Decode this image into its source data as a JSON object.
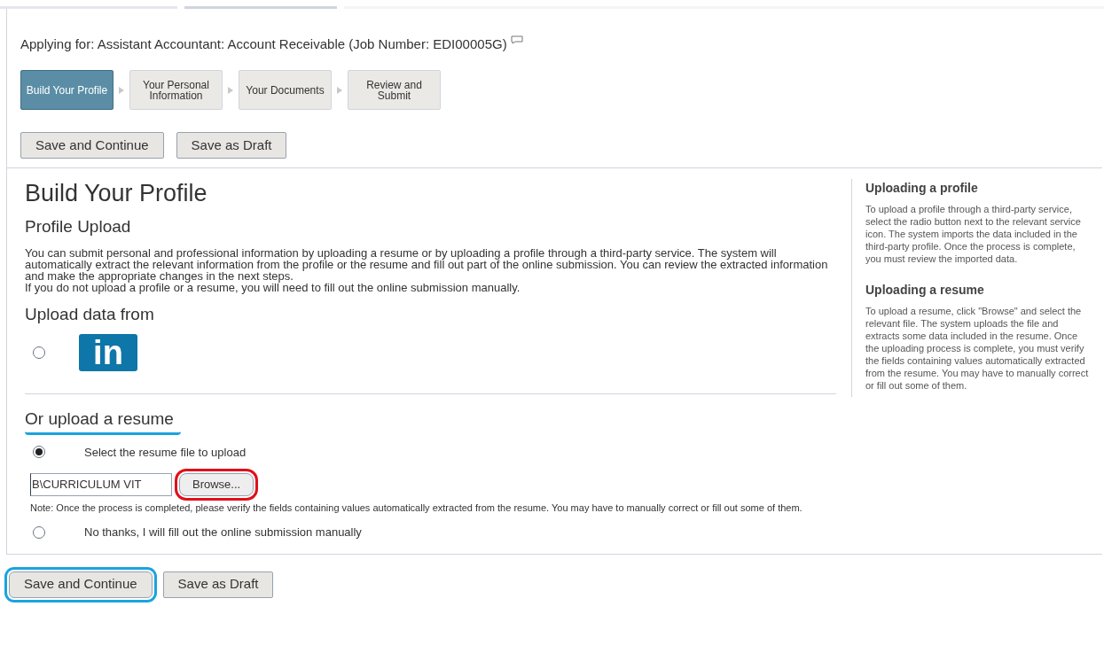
{
  "header": {
    "label": "Applying for:",
    "job_title": "Assistant Accountant: Account Receivable (Job Number: EDI00005G)"
  },
  "steps": [
    {
      "label": "Build Your Profile",
      "selected": true
    },
    {
      "label": "Your Personal Information",
      "selected": false
    },
    {
      "label": "Your Documents",
      "selected": false
    },
    {
      "label": "Review and Submit",
      "selected": false
    }
  ],
  "top_buttons": [
    {
      "label": "Save and Continue",
      "circled": false
    },
    {
      "label": "Save as Draft",
      "circled": false
    }
  ],
  "main": {
    "title": "Build Your Profile",
    "subtitle": "Profile Upload",
    "paragraphs": [
      "You can submit personal and professional information by uploading a resume or by uploading a profile through a third-party service. The system will automatically extract the relevant information from the profile or the resume and fill out part of the online submission. You can review the extracted information and make the appropriate changes in the next steps.",
      "If you do not upload a profile or a resume, you will need to fill out the online submission manually."
    ],
    "upload_heading": "Upload data from",
    "service": {
      "logo_text": "in",
      "selected": false
    },
    "resume_heading": {
      "text": "Or upload a resume",
      "underlined": true
    },
    "resume_option": {
      "label": "Select the resume file to upload",
      "selected": true
    },
    "file_field": {
      "value": "B\\CURRICULUM VIT"
    },
    "browse_button": {
      "label": "Browse...",
      "circled": true
    },
    "note": "Note: Once the process is completed, please verify the fields containing values automatically extracted from the resume. You may have to manually correct or fill out some of them.",
    "manual_option": {
      "label": "No thanks, I will fill out the online submission manually",
      "selected": false
    }
  },
  "sidebar": [
    {
      "title": "Uploading a profile",
      "text": "To upload a profile through a third-party service, select the radio button next to the relevant service icon. The system imports the data included in the third-party profile. Once the process is complete, you must review the imported data."
    },
    {
      "title": "Uploading a resume",
      "text": "To upload a resume, click \"Browse\" and select the relevant file. The system uploads the file and extracts some data included in the resume. Once the uploading process is complete, you must verify the fields containing values automatically extracted from the resume. You may have to manually correct or fill out some of them."
    }
  ],
  "bottom_buttons": [
    {
      "label": "Save and Continue",
      "circled": true
    },
    {
      "label": "Save as Draft",
      "circled": false
    }
  ]
}
